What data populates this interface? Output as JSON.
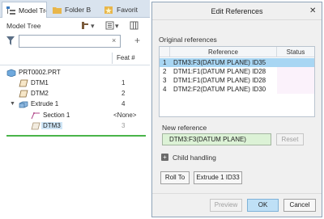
{
  "left_panel": {
    "tabs": [
      {
        "label": "Model Tree",
        "icon": "model-tree-icon",
        "active": true
      },
      {
        "label": "Folder B",
        "icon": "folder-icon",
        "active": false
      },
      {
        "label": "Favorit",
        "icon": "favorites-icon",
        "active": false
      }
    ],
    "header": {
      "title": "Model Tree"
    },
    "search": {
      "value": "",
      "placeholder": ""
    },
    "columns": {
      "feat": "Feat #"
    },
    "tree": [
      {
        "label": "PRT0002.PRT",
        "num": "",
        "icon": "part-icon",
        "indent": 0
      },
      {
        "label": "DTM1",
        "num": "1",
        "icon": "datum-plane-icon",
        "indent": 1
      },
      {
        "label": "DTM2",
        "num": "2",
        "icon": "datum-plane-icon",
        "indent": 1
      },
      {
        "label": "Extrude 1",
        "num": "4",
        "icon": "extrude-icon",
        "indent": 1,
        "expanded": true
      },
      {
        "label": "Section 1",
        "num": "<None>",
        "icon": "sketch-icon",
        "indent": 2
      },
      {
        "label": "DTM3",
        "num": "3",
        "icon": "datum-plane-icon",
        "indent": 2,
        "selected": true,
        "dim_num": true
      }
    ]
  },
  "dialog": {
    "title": "Edit References",
    "original_label": "Original references",
    "table_headers": {
      "reference": "Reference",
      "status": "Status"
    },
    "rows": [
      {
        "num": "1",
        "ref": "DTM3:F3(DATUM PLANE) ID35",
        "status": "",
        "selected": true
      },
      {
        "num": "2",
        "ref": "DTM1:F1(DATUM PLANE) ID28",
        "status": ""
      },
      {
        "num": "3",
        "ref": "DTM1:F1(DATUM PLANE) ID28",
        "status": ""
      },
      {
        "num": "4",
        "ref": "DTM2:F2(DATUM PLANE) ID30",
        "status": ""
      }
    ],
    "new_ref_label": "New reference",
    "new_ref_value": "DTM3:F3(DATUM PLANE)",
    "reset_label": "Reset",
    "child_handling_label": "Child handling",
    "roll_to_label": "Roll To",
    "roll_to_target": "Extrude 1 ID33",
    "preview_label": "Preview",
    "ok_label": "OK",
    "cancel_label": "Cancel"
  }
}
